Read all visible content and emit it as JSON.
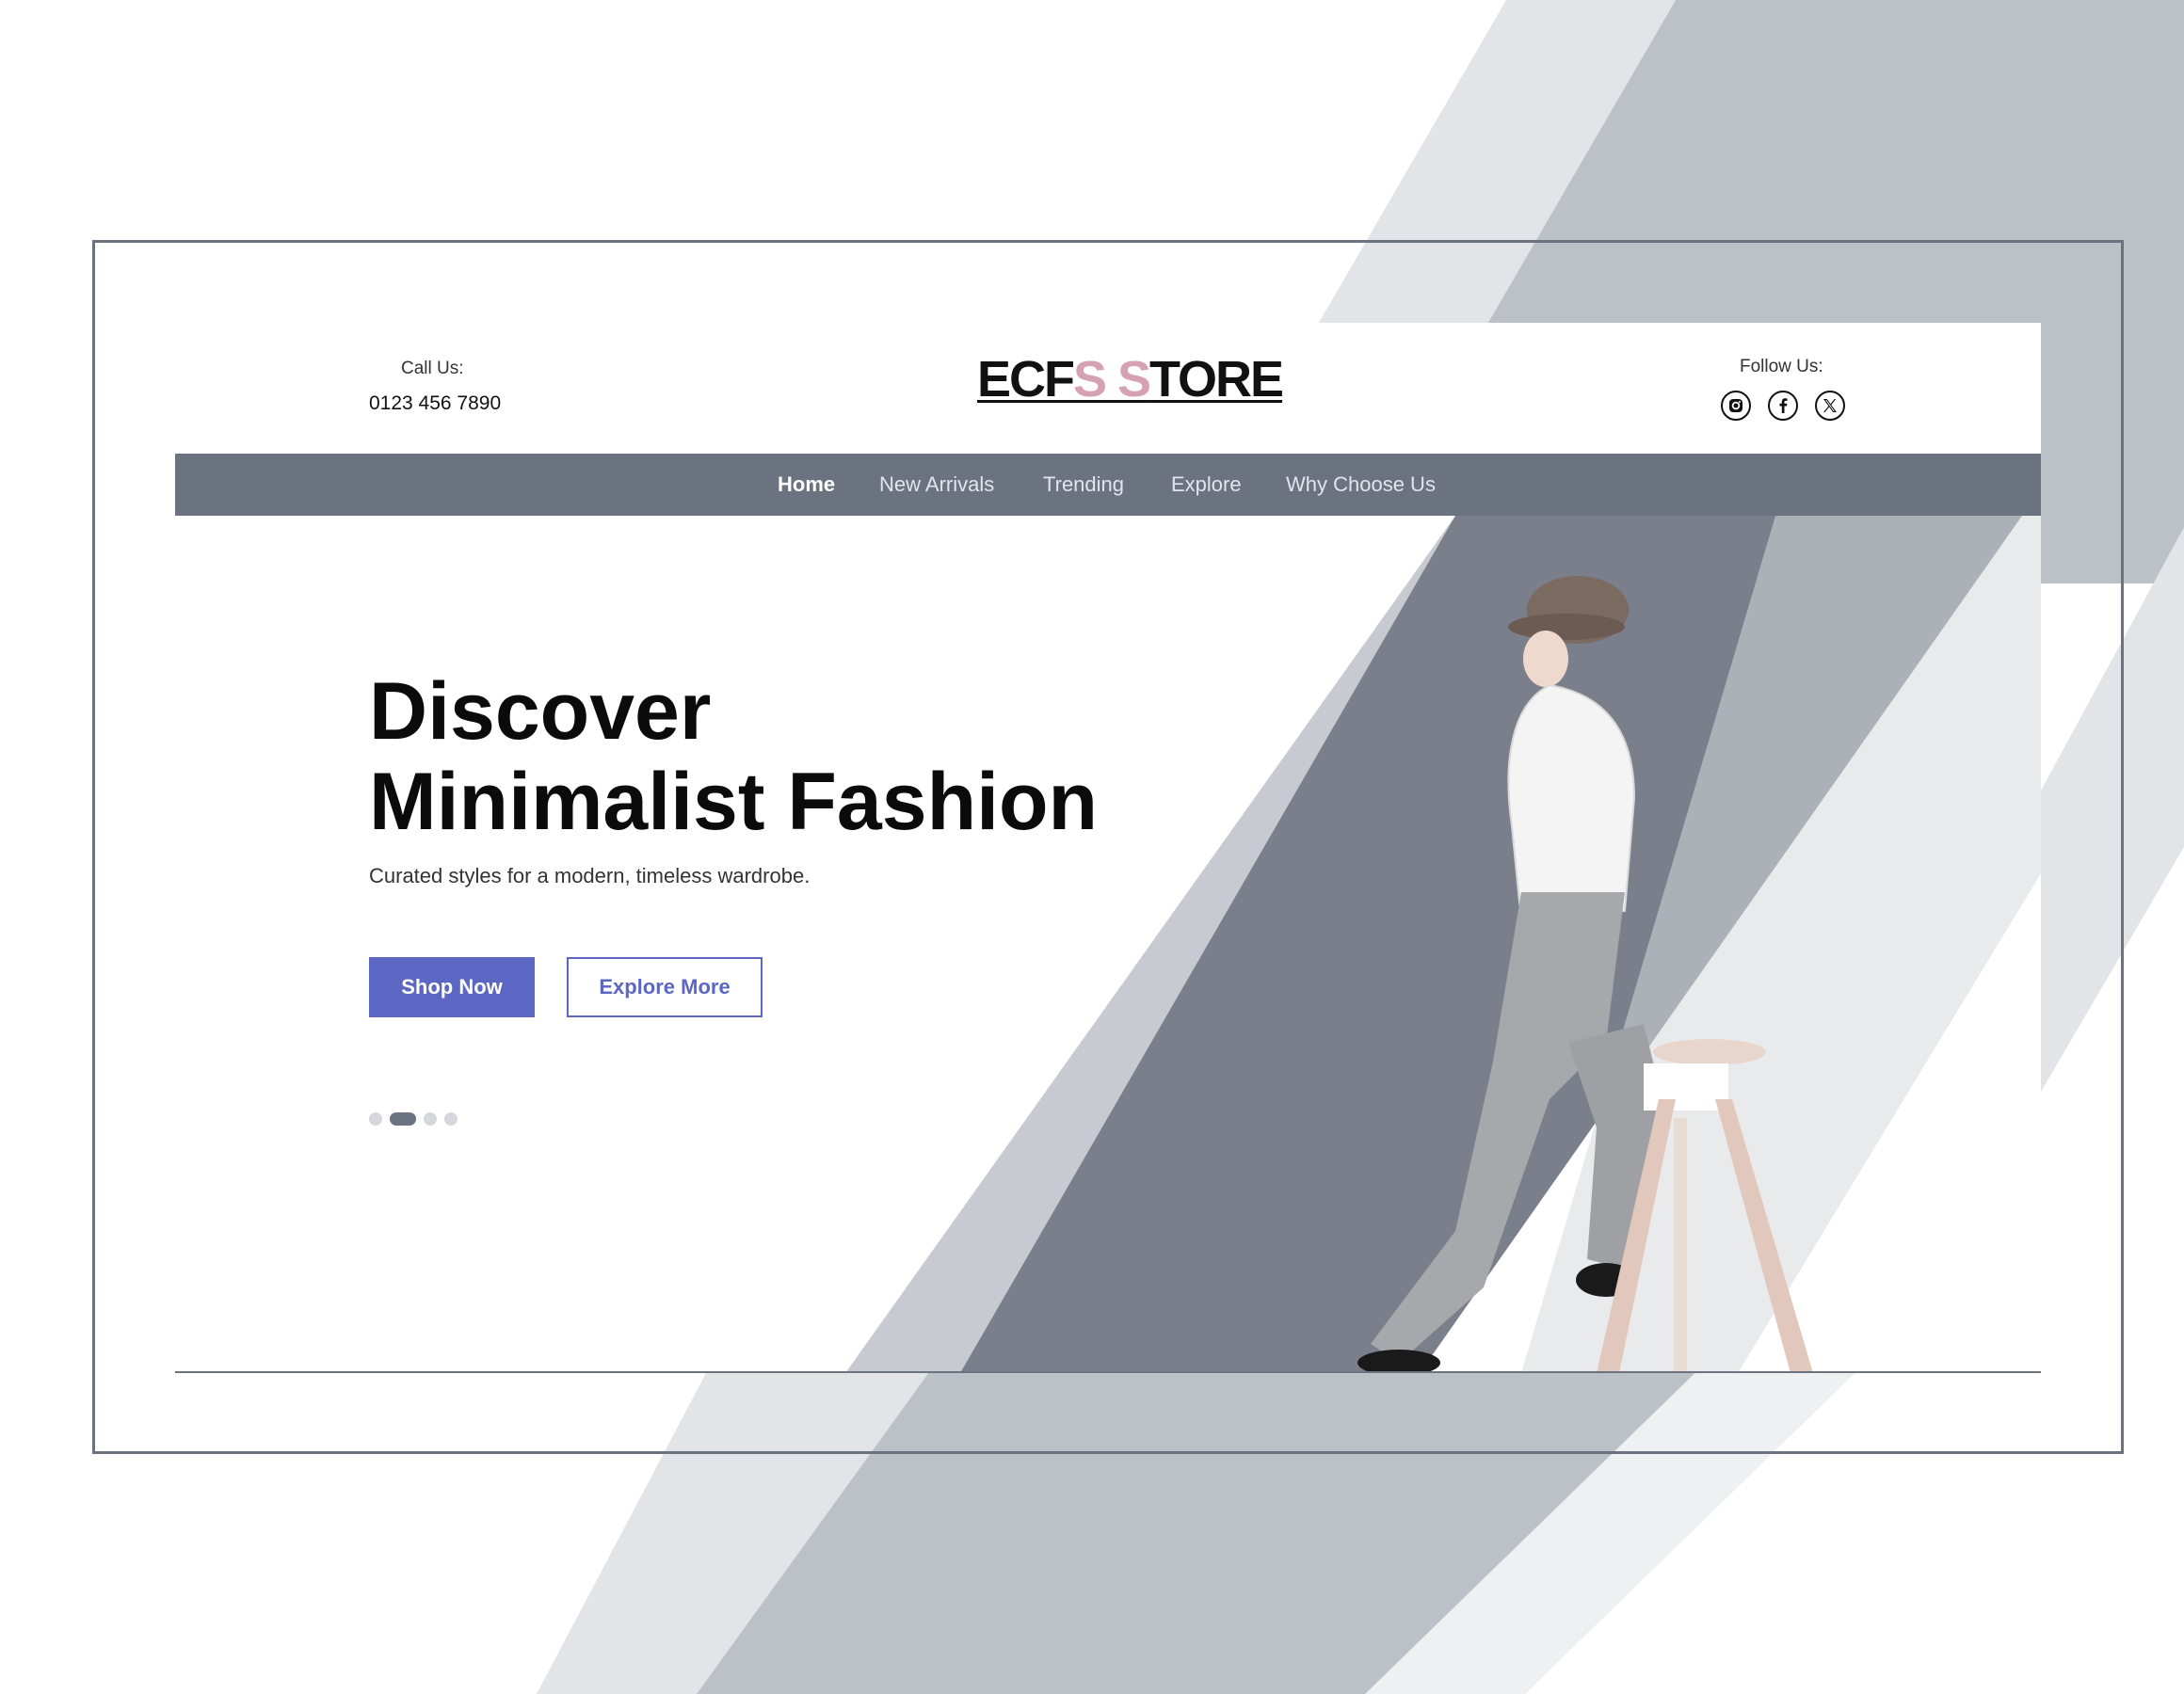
{
  "header": {
    "call_label": "Call Us:",
    "phone": "0123 456 7890",
    "logo_part1": "ECF",
    "logo_part2": "S S",
    "logo_part3": "TORE",
    "follow_label": "Follow Us:",
    "social_icons": [
      "instagram-icon",
      "facebook-icon",
      "x-icon"
    ]
  },
  "nav": {
    "items": [
      "Home",
      "New Arrivals",
      "Trending",
      "Explore",
      "Why Choose Us"
    ],
    "active": "Home"
  },
  "hero": {
    "title_line1": "Discover",
    "title_line2": "Minimalist Fashion",
    "subtitle": "Curated styles for a modern, timeless wardrobe.",
    "primary_button": "Shop Now",
    "secondary_button": "Explore More",
    "slide_count": 4,
    "active_slide": 2
  },
  "colors": {
    "accent": "#5b67c2",
    "nav_bg": "#6b7280",
    "logo_pink": "#d6a2b2",
    "stripe_light": "#e2e4e8",
    "stripe_mid": "#bcc0c7",
    "stripe_dark": "#7a7f8b"
  }
}
